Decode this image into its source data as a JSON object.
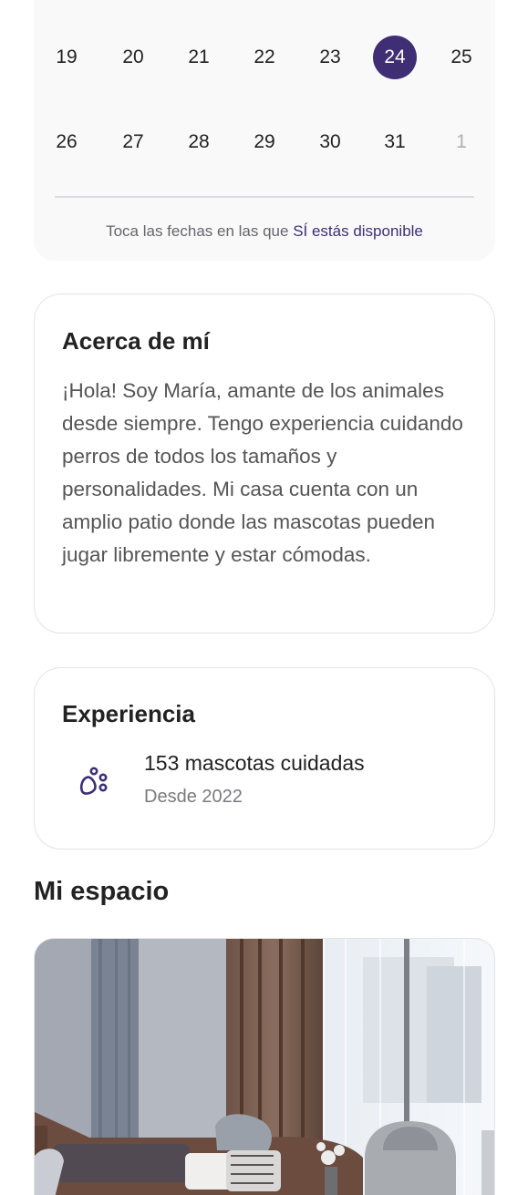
{
  "calendar": {
    "rows": [
      [
        {
          "day": "19",
          "state": "normal"
        },
        {
          "day": "20",
          "state": "normal"
        },
        {
          "day": "21",
          "state": "normal"
        },
        {
          "day": "22",
          "state": "normal"
        },
        {
          "day": "23",
          "state": "normal"
        },
        {
          "day": "24",
          "state": "selected"
        },
        {
          "day": "25",
          "state": "normal"
        }
      ],
      [
        {
          "day": "26",
          "state": "normal"
        },
        {
          "day": "27",
          "state": "normal"
        },
        {
          "day": "28",
          "state": "normal"
        },
        {
          "day": "29",
          "state": "normal"
        },
        {
          "day": "30",
          "state": "normal"
        },
        {
          "day": "31",
          "state": "normal"
        },
        {
          "day": "1",
          "state": "muted"
        }
      ]
    ],
    "hint_prefix": "Toca las fechas en las que",
    "hint_highlight": "SÍ estás disponible"
  },
  "about": {
    "title": "Acerca de mí",
    "text": "¡Hola! Soy María, amante de los animales desde siempre. Tengo experiencia cuidando perros de todos los tamaños y personalidades. Mi casa cuenta con un amplio patio donde las mascotas pueden jugar libremente y estar cómodas."
  },
  "experience": {
    "title": "Experiencia",
    "icon": "paw-icon",
    "main": "153 mascotas cuidadas",
    "sub": "Desde 2022"
  },
  "space": {
    "title": "Mi espacio",
    "photo_alt": "living-room-photo"
  },
  "colors": {
    "accent": "#3f2e74",
    "card_bg": "#f9f9fa",
    "border": "#e4e4e7"
  }
}
